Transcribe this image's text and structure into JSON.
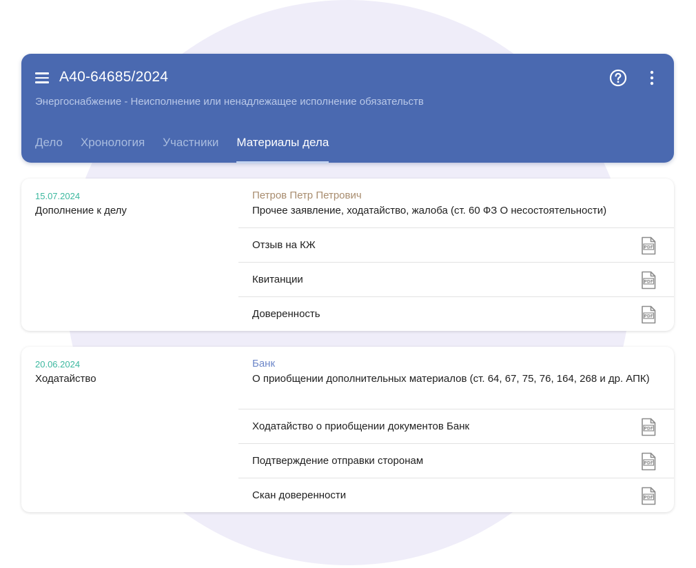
{
  "header": {
    "case_number": "А40-64685/2024",
    "subtitle": "Энергоснабжение - Неисполнение или ненадлежащее исполнение обязательств",
    "tabs": [
      {
        "label": "Дело",
        "active": false
      },
      {
        "label": "Хронология",
        "active": false
      },
      {
        "label": "Участники",
        "active": false
      },
      {
        "label": "Материалы дела",
        "active": true
      }
    ],
    "icons": [
      "menu-icon",
      "help-icon",
      "more-vertical-icon"
    ]
  },
  "colors": {
    "header_bg": "#4a69b0",
    "date": "#3cb89f",
    "party_1": "#a88c6e",
    "party_2": "#6d87c9",
    "background_circle": "#efedf9"
  },
  "entries": [
    {
      "date": "15.07.2024",
      "type": "Дополнение к делу",
      "party": "Петров Петр Петрович",
      "description": "Прочее заявление, ходатайство, жалоба (ст. 60 ФЗ О несостоятельности)",
      "documents": [
        {
          "label": "Отзыв на КЖ",
          "icon": "pdf-icon"
        },
        {
          "label": "Квитанции",
          "icon": "pdf-icon"
        },
        {
          "label": "Доверенность",
          "icon": "pdf-icon"
        }
      ]
    },
    {
      "date": "20.06.2024",
      "type": "Ходатайство",
      "party": "Банк",
      "description": "О приобщении дополнительных материалов (ст. 64, 67, 75, 76, 164, 268 и др. АПК)",
      "documents": [
        {
          "label": "Ходатайство о приобщении документов Банк",
          "icon": "pdf-icon"
        },
        {
          "label": "Подтверждение отправки сторонам",
          "icon": "pdf-icon"
        },
        {
          "label": "Скан доверенности",
          "icon": "pdf-icon"
        }
      ]
    }
  ]
}
